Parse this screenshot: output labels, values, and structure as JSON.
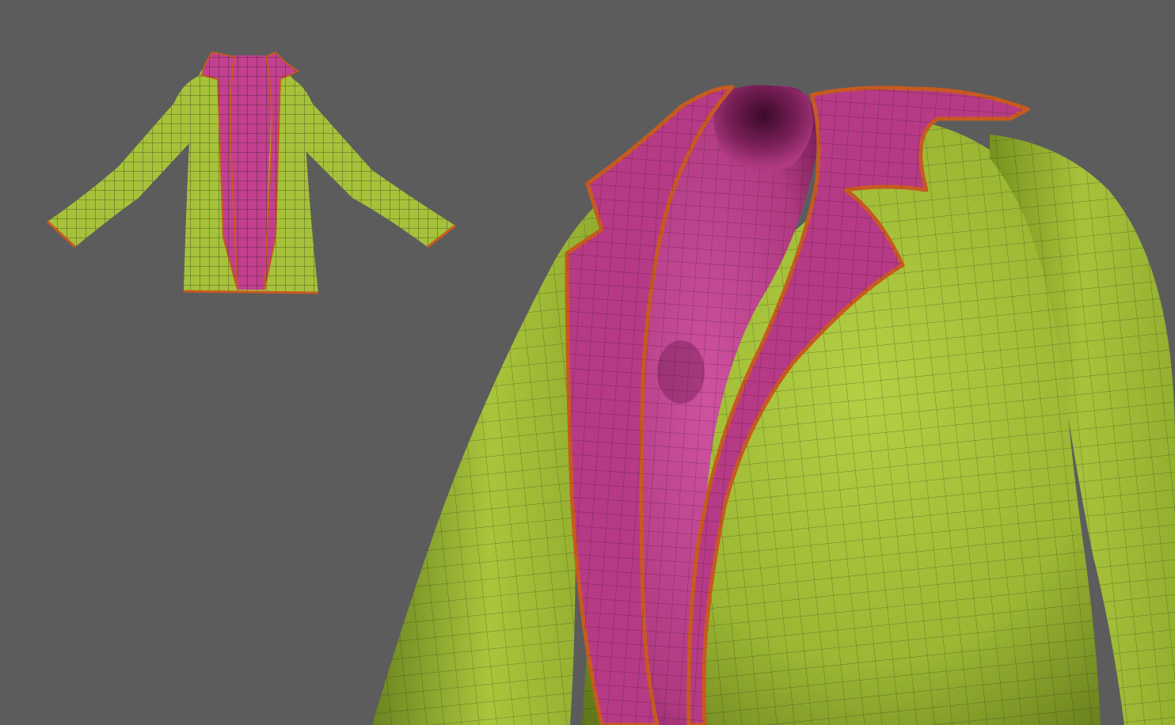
{
  "scene": {
    "background_color": "#5c5c5c",
    "colors": {
      "jacket_body": "#a6c23a",
      "jacket_body_shadow": "#6f8a1f",
      "lining": "#c2408f",
      "lining_shadow": "#7a1f58",
      "trim": "#c85a20",
      "wireframe": "#1a1a14"
    },
    "views": [
      {
        "name": "full-jacket-thumbnail",
        "icon": "jacket-wireframe"
      },
      {
        "name": "collar-closeup",
        "icon": "jacket-wireframe"
      }
    ]
  }
}
